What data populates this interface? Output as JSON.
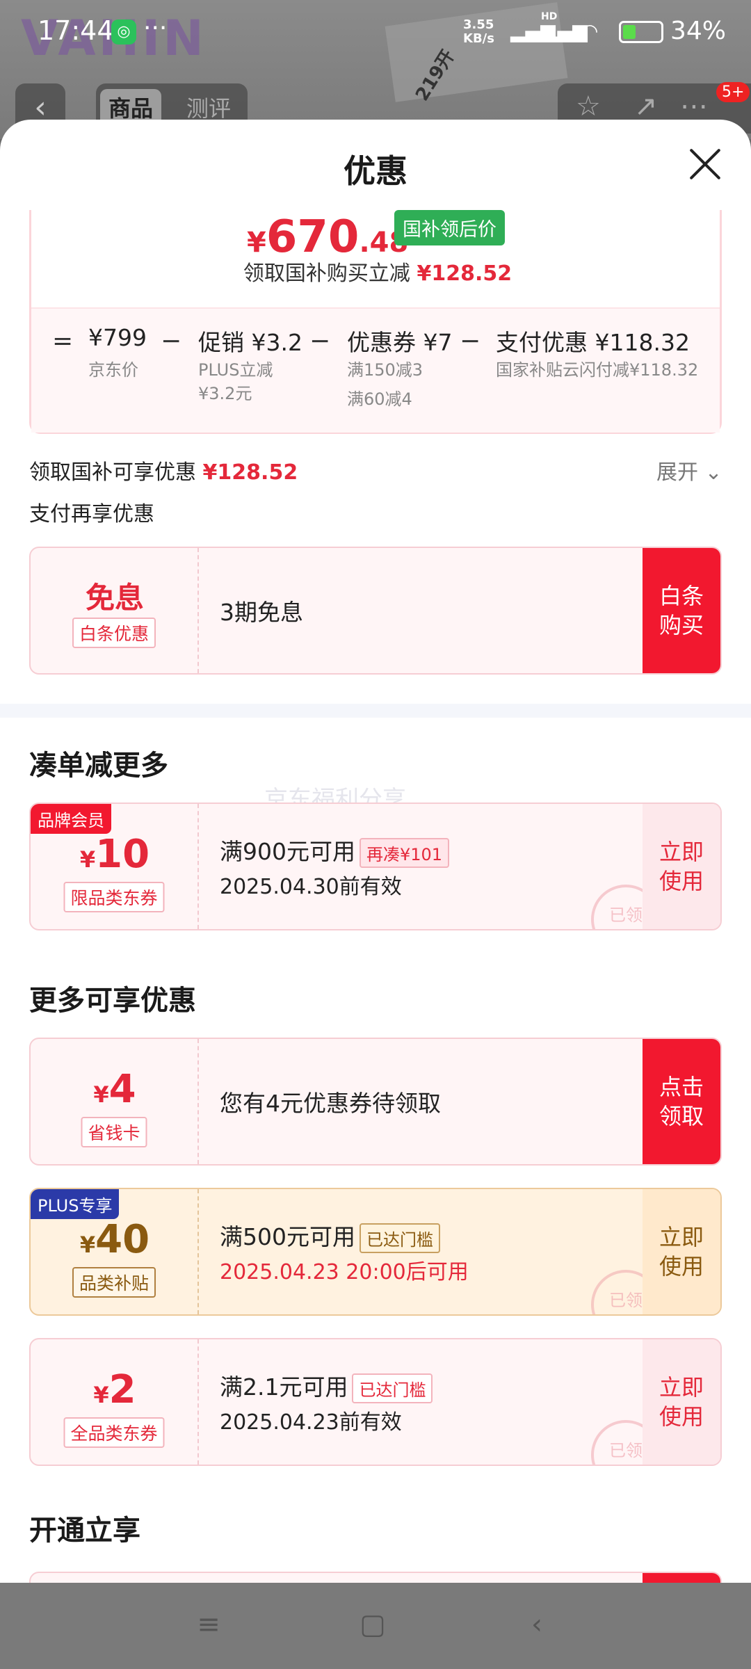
{
  "status_bar": {
    "time": "17:44",
    "net_speed": "3.55 KB/s",
    "hd1": "HD",
    "hd2": "HD",
    "battery": "34%"
  },
  "background_page": {
    "logo": "VAHIN",
    "poster_text": "219开",
    "tabs": [
      "商品",
      "测评"
    ],
    "badge": "5+"
  },
  "sheet": {
    "title": "优惠",
    "price": {
      "currency": "¥",
      "integer": "670",
      "decimal": ".48",
      "tag": "国补领后价"
    },
    "subtitle": {
      "text": "领取国补购买立减",
      "amount": "¥128.52"
    },
    "breakdown": {
      "eq": "=",
      "jd_price": "¥799",
      "jd_label": "京东价",
      "minus": "−",
      "promo": "促销 ¥3.2",
      "promo_sub1": "PLUS立减",
      "promo_sub2": "¥3.2元",
      "coupon": "优惠券 ¥7",
      "coupon_sub1": "满150减3",
      "coupon_sub2": "满60减4",
      "pay": "支付优惠 ¥118.32",
      "pay_sub": "国家补贴云闪付减¥118.32"
    },
    "guobu_row": {
      "text": "领取国补可享优惠",
      "amount": "¥128.52",
      "expand": "展开"
    },
    "pay_more": "支付再享优惠",
    "baitiao": {
      "big": "免息",
      "tag": "白条优惠",
      "desc": "3期免息",
      "action": "白条\n购买"
    },
    "section1": "凑单减更多",
    "watermark": "京东福利分享",
    "coupon_brand": {
      "ribbon": "品牌会员",
      "amount": "10",
      "currency": "¥",
      "tag": "限品类东券",
      "cond": "满900元可用",
      "extra": "再凑¥101",
      "valid": "2025.04.30前有效",
      "action": "立即\n使用",
      "stamp": "已领"
    },
    "section2": "更多可享优惠",
    "coupon_save": {
      "amount": "4",
      "currency": "¥",
      "tag": "省钱卡",
      "desc": "您有4元优惠券待领取",
      "action": "点击\n领取"
    },
    "coupon_plus": {
      "ribbon": "PLUS专享",
      "amount": "40",
      "currency": "¥",
      "tag": "品类补贴",
      "cond": "满500元可用",
      "extra": "已达门槛",
      "valid": "2025.04.23 20:00后可用",
      "action": "立即\n使用",
      "stamp": "已领"
    },
    "coupon_all": {
      "amount": "2",
      "currency": "¥",
      "tag": "全品类东券",
      "cond": "满2.1元可用",
      "extra": "已达门槛",
      "valid": "2025.04.23前有效",
      "action": "立即\n使用",
      "stamp": "已领"
    },
    "section3": "开通立享"
  },
  "colors": {
    "accent_red": "#e4283a",
    "button_red": "#f2182f",
    "green_tag": "#2fae56",
    "plus_blue": "#2b3aa8",
    "gold": "#8a5a10"
  }
}
